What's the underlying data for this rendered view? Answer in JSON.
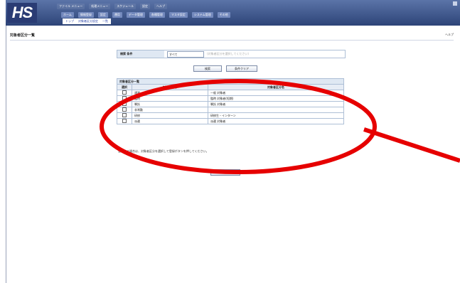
{
  "app": {
    "logo": "HS"
  },
  "header": {
    "menu_row1": [
      "ファイル メニュー",
      "処理メニュー",
      "スケジュール",
      "設定",
      "ヘルプ"
    ],
    "menu_row2": [
      "ホーム",
      "情報登録",
      "設定",
      "運用",
      "データ管理",
      "各種管理",
      "マスタ設定",
      "システム管理",
      "その他"
    ],
    "breadcrumb": [
      "トップ",
      "対象者区分設定",
      "一覧"
    ]
  },
  "page": {
    "title": "対象者区分一覧",
    "right_label": "ヘルプ"
  },
  "filter": {
    "label": "検索 条件",
    "select_value": "すべて",
    "hint": "(対象者区分を選択してください)"
  },
  "buttons": {
    "search": "検索",
    "clear": "条件クリア",
    "register": "登録"
  },
  "table": {
    "caption": "対象者区分一覧",
    "columns": [
      "選択",
      "対象者区分",
      "対象者区分名"
    ],
    "rows": [
      {
        "type": "通常",
        "name": "一般 対象者"
      },
      {
        "type": "臨時",
        "name": "臨時 対象者(短期)"
      },
      {
        "type": "嘱託",
        "name": "嘱託 対象者"
      },
      {
        "type": "非常勤",
        "name": ""
      },
      {
        "type": "研修",
        "name": "研修生・インターン"
      },
      {
        "type": "派遣",
        "name": "派遣 対象者"
      }
    ]
  },
  "note": "登録する場合は、対象者区分を選択して登録ボタンを押してください。",
  "colors": {
    "annotation": "#e60000",
    "header": "#2d4478"
  }
}
